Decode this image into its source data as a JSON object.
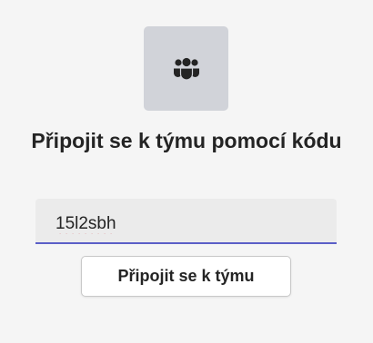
{
  "icon": "team-people-icon",
  "title": "Připojit se k týmu pomocí kódu",
  "code_field": {
    "value": "15l2sbh"
  },
  "join_button_label": "Připojit se k týmu",
  "colors": {
    "accent": "#5b5fc7",
    "icon_tile": "#d1d3d9",
    "background": "#f5f5f5",
    "spellcheck_underline": "#d13438"
  }
}
